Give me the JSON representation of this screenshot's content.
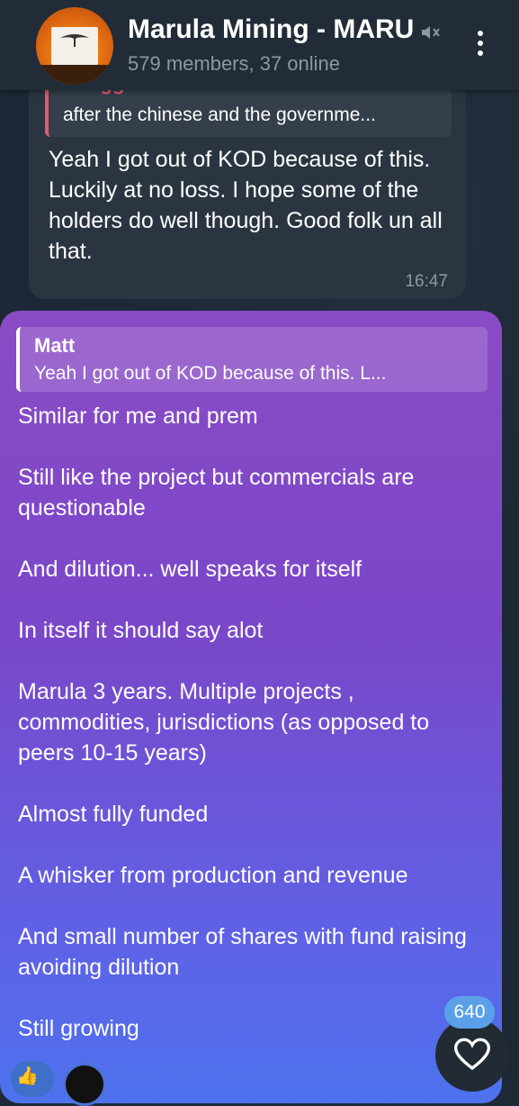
{
  "header": {
    "title": "Marula Mining - MARU",
    "subtitle": "579 members, 37 online",
    "icons": [
      "mute-icon",
      "more-vert-icon"
    ]
  },
  "incoming": {
    "reply_name": "Chaggs",
    "reply_text": "after the chinese and the governme...",
    "body": "Yeah I got out of KOD because of this. Luckily at no loss. I hope some of the holders do well though. Good folk un all that.",
    "time": "16:47"
  },
  "outgoing": {
    "reply_name": "Matt",
    "reply_text": "Yeah I got out of KOD because of this. L...",
    "paragraphs": [
      "Similar for me and prem",
      "Still like the project but commercials are questionable",
      "And dilution... well speaks for itself",
      "In itself it should say alot",
      "Marula 3 years. Multiple projects , commodities,  jurisdictions (as opposed to peers 10-15 years)",
      "Almost fully funded",
      "A whisker from production and revenue",
      "And small number of shares with fund raising avoiding dilution",
      "Still growing"
    ]
  },
  "reaction": {
    "count": "640"
  }
}
